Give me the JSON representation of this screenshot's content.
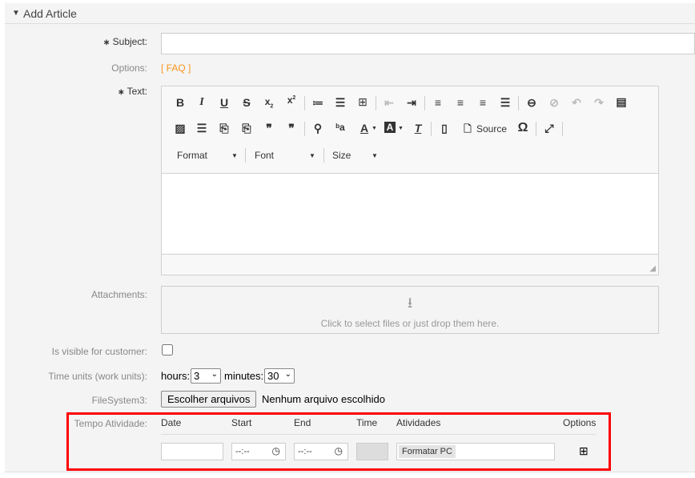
{
  "section": {
    "title": "Add Article"
  },
  "fields": {
    "subject_label": "Subject:",
    "options_label": "Options:",
    "options_link": "[ FAQ ]",
    "text_label": "Text:",
    "attachments_label": "Attachments:",
    "attachments_hint": "Click to select files or just drop them here.",
    "visible_label": "Is visible for customer:",
    "visible_checked": false,
    "time_units_label": "Time units (work units):",
    "hours_label": "hours:",
    "hours_value": "3",
    "minutes_label": "minutes:",
    "minutes_value": "30",
    "filesystem_label": "FileSystem3:",
    "file_button": "Escolher arquivos",
    "file_status": "Nenhum arquivo escolhido"
  },
  "editor": {
    "source_label": "Source",
    "format_label": "Format",
    "font_label": "Font",
    "size_label": "Size"
  },
  "tempo": {
    "label": "Tempo Atividade:",
    "headers": [
      "Date",
      "Start",
      "End",
      "Time",
      "Atividades",
      "Options"
    ],
    "row": {
      "date": "",
      "start": "--:--",
      "end": "--:--",
      "time": "",
      "atividade": "Formatar PC"
    }
  },
  "colors": {
    "link": "#f7941d",
    "highlight": "#ff0000",
    "required": "#000000"
  }
}
